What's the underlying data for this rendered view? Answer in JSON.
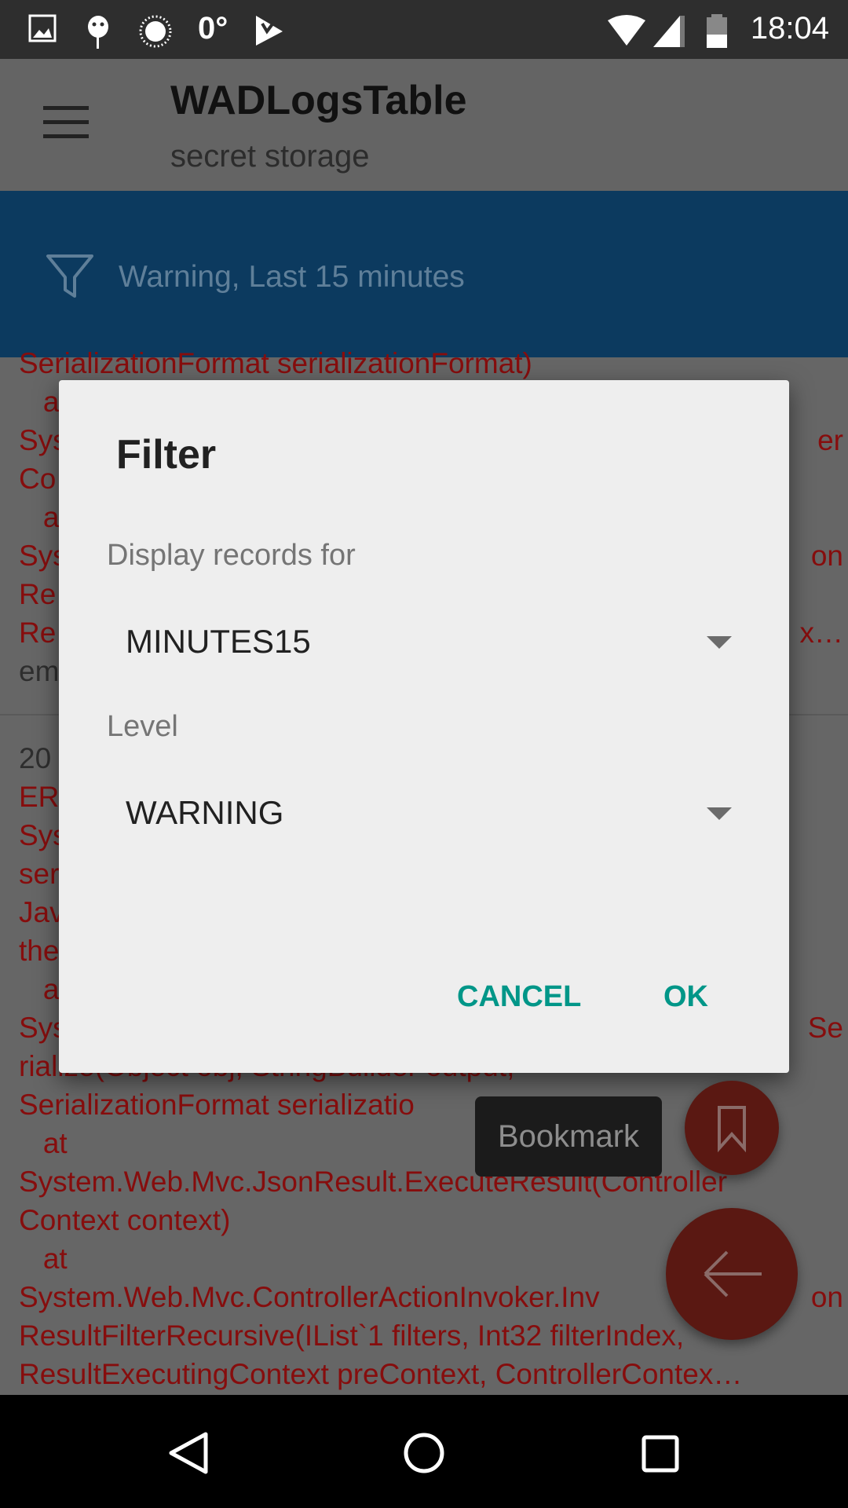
{
  "status_bar": {
    "time": "18:04",
    "temperature": "0°",
    "icons": [
      "image-icon",
      "android-debug-icon",
      "brightness-icon",
      "temperature",
      "check-app-icon",
      "wifi-icon",
      "signal-icon",
      "battery-icon"
    ]
  },
  "toolbar": {
    "title": "WADLogsTable",
    "subtitle": "secret storage",
    "menu_icon": "hamburger-menu-icon"
  },
  "filter_bar": {
    "icon": "filter-icon",
    "text": "Warning, Last 15 minutes",
    "color": "#0c3a5f"
  },
  "log_block_1": [
    {
      "left": "SerializationFormat serializationFormat)",
      "right": ""
    },
    {
      "left": "   a",
      "right": ""
    },
    {
      "left": "Sys",
      "right": "er"
    },
    {
      "left": "Co",
      "right": ""
    },
    {
      "left": "   a",
      "right": ""
    },
    {
      "left": "Sys",
      "right": "on"
    },
    {
      "left": "Re",
      "right": ""
    },
    {
      "left": "Re",
      "right": "x…"
    },
    {
      "left": "em",
      "right": "",
      "gray": true
    }
  ],
  "log_block_2": [
    {
      "left": "20",
      "right": "",
      "gray": true
    },
    {
      "left": "ER",
      "right": ""
    },
    {
      "left": "Sys",
      "right": ""
    },
    {
      "left": "ser",
      "right": ""
    },
    {
      "left": "Jav",
      "right": ""
    },
    {
      "left": "the",
      "right": ""
    },
    {
      "left": "   a",
      "right": ""
    },
    {
      "left": "Sys",
      "right": "Se"
    },
    {
      "left": "rialize(Object obj, StringBuilder output,",
      "right": ""
    },
    {
      "left": "SerializationFormat serializatio",
      "right": ""
    },
    {
      "left": "   at",
      "right": ""
    },
    {
      "left": "System.Web.Mvc.JsonResult.ExecuteResult(Controller",
      "right": ""
    },
    {
      "left": "Context context)",
      "right": ""
    },
    {
      "left": "   at",
      "right": ""
    },
    {
      "left": "System.Web.Mvc.ControllerActionInvoker.Inv",
      "right": "on"
    },
    {
      "left": "ResultFilterRecursive(IList`1 filters, Int32 filterIndex,",
      "right": ""
    },
    {
      "left": "ResultExecutingContext preContext, ControllerContex…",
      "right": ""
    }
  ],
  "dialog": {
    "title": "Filter",
    "display_label": "Display records for",
    "display_value": "MINUTES15",
    "level_label": "Level",
    "level_value": "WARNING",
    "cancel": "CANCEL",
    "ok": "OK",
    "accent": "#009688"
  },
  "tooltip": "Bookmark",
  "fabs": {
    "bookmark_icon": "bookmark-icon",
    "back_icon": "arrow-left-icon"
  },
  "nav": {
    "back": "back-icon",
    "home": "home-icon",
    "recents": "recents-icon"
  }
}
